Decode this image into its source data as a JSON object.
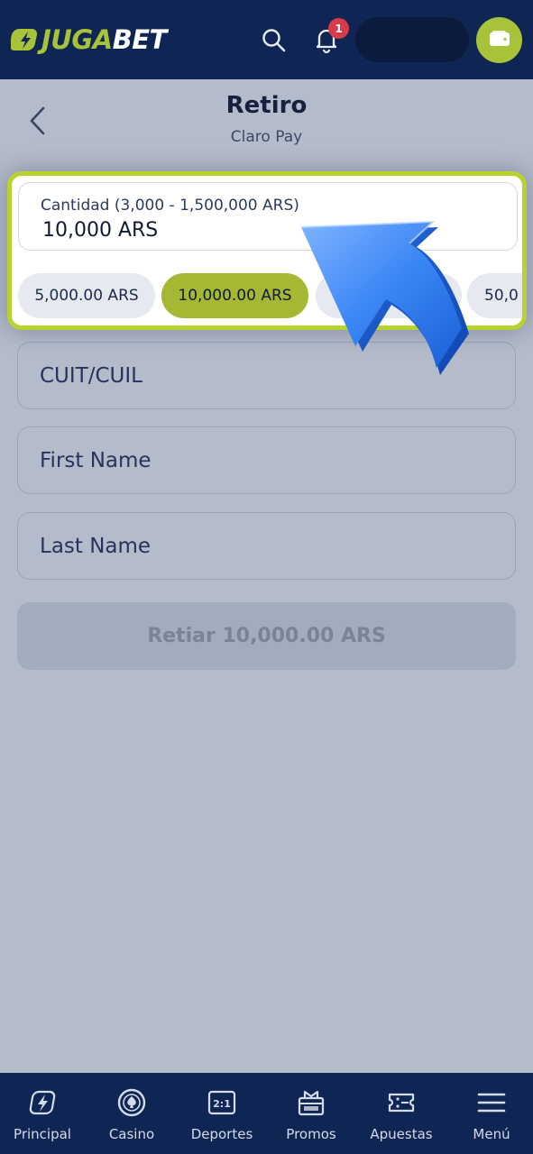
{
  "header": {
    "logo_juga": "JUGA",
    "logo_bet": "BET",
    "notification_count": "1",
    "search_icon": "search-icon",
    "bell_icon": "bell-icon",
    "wallet_icon": "wallet-icon",
    "brand_color": "#a8c33a",
    "header_color": "#0f2654"
  },
  "page": {
    "title": "Retiro",
    "subtitle": "Claro Pay",
    "back_icon": "chevron-left-icon"
  },
  "amount": {
    "label": "Cantidad (3,000 - 1,500,000 ARS)",
    "value": "10,000 ARS",
    "chips": [
      {
        "label": "5,000.00 ARS",
        "selected": false
      },
      {
        "label": "10,000.00 ARS",
        "selected": true
      },
      {
        "label": "",
        "selected": false
      },
      {
        "label": "50,0",
        "selected": false
      }
    ]
  },
  "form": {
    "cuit_placeholder": "CUIT/CUIL",
    "first_name_placeholder": "First Name",
    "last_name_placeholder": "Last Name",
    "submit_label": "Retiar 10,000.00 ARS"
  },
  "bottom_nav": {
    "items": [
      {
        "label": "Principal",
        "icon": "lightning-icon"
      },
      {
        "label": "Casino",
        "icon": "spade-chip-icon"
      },
      {
        "label": "Deportes",
        "icon": "odds-icon"
      },
      {
        "label": "Promos",
        "icon": "gift-icon"
      },
      {
        "label": "Apuestas",
        "icon": "ticket-icon"
      },
      {
        "label": "Menú",
        "icon": "menu-icon"
      }
    ]
  }
}
